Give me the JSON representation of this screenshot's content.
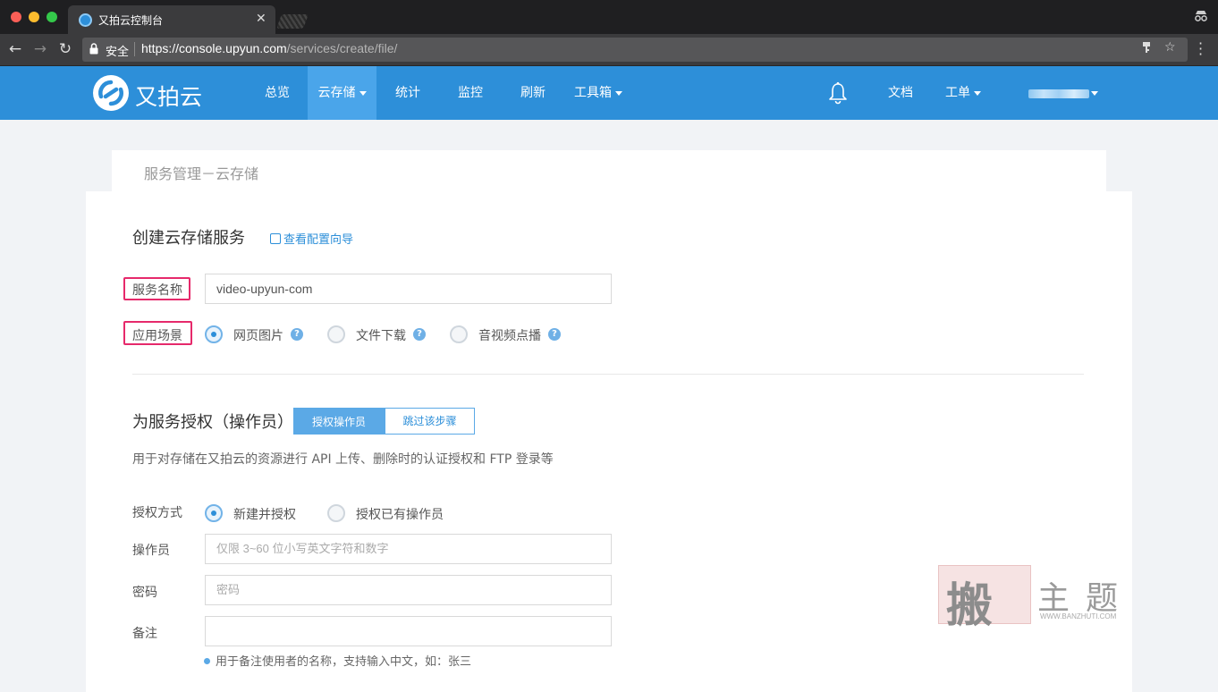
{
  "browser": {
    "tab_title": "又拍云控制台",
    "tab_close": "✕",
    "secure_label": "安全",
    "url_base": "https://console.upyun.com",
    "url_path": "/services/create/file/"
  },
  "header": {
    "logo_text": "又拍云",
    "nav": [
      {
        "label": "总览"
      },
      {
        "label": "云存储",
        "active": true,
        "dropdown": true
      },
      {
        "label": "统计"
      },
      {
        "label": "监控"
      },
      {
        "label": "刷新"
      },
      {
        "label": "工具箱",
        "dropdown": true
      }
    ],
    "docs_label": "文档",
    "ticket_label": "工单"
  },
  "breadcrumb": "服务管理－云存储",
  "create_section": {
    "title": "创建云存储服务",
    "guide_link": "查看配置向导",
    "service_name_label": "服务名称",
    "service_name_value": "video-upyun-com",
    "scenario_label": "应用场景",
    "scenarios": [
      {
        "label": "网页图片",
        "checked": true
      },
      {
        "label": "文件下载",
        "checked": false
      },
      {
        "label": "音视频点播",
        "checked": false
      }
    ]
  },
  "auth_section": {
    "title": "为服务授权（操作员）",
    "authorize_button": "授权操作员",
    "skip_button": "跳过该步骤",
    "description": "用于对存储在又拍云的资源进行 API 上传、删除时的认证授权和 FTP 登录等",
    "method_label": "授权方式",
    "methods": [
      {
        "label": "新建并授权",
        "checked": true
      },
      {
        "label": "授权已有操作员",
        "checked": false
      }
    ],
    "operator_label": "操作员",
    "operator_placeholder": "仅限 3~60 位小写英文字符和数字",
    "password_label": "密码",
    "password_placeholder": "密码",
    "note_label": "备注",
    "note_value": "",
    "note_hint": "用于备注使用者的名称，支持输入中文，如：张三"
  },
  "watermark": {
    "seal": "搬",
    "text": "主题",
    "url": "WWW.BANZHUTI.COM"
  },
  "colors": {
    "brand": "#2d8fd9",
    "highlight": "#e6296b"
  }
}
